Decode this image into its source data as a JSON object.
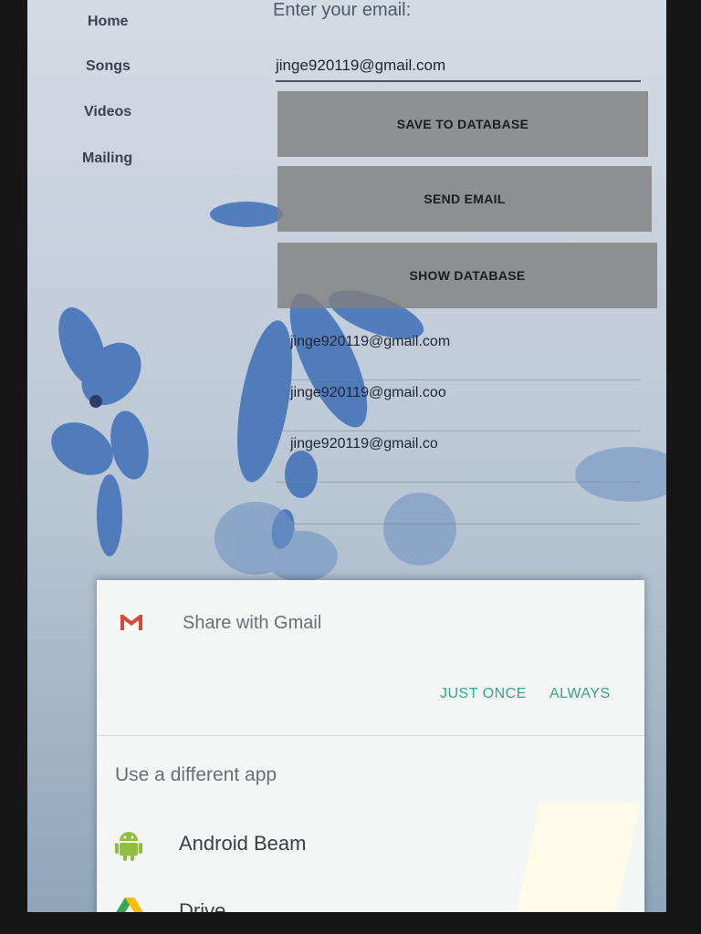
{
  "sidebar": {
    "items": [
      {
        "label": "Home"
      },
      {
        "label": "Songs"
      },
      {
        "label": "Videos"
      },
      {
        "label": "Mailing"
      }
    ]
  },
  "form": {
    "email_label": "Enter your email:",
    "email_value": "jinge920119@gmail.com",
    "save_button": "SAVE TO DATABASE",
    "send_button": "SEND EMAIL",
    "show_button": "SHOW DATABASE"
  },
  "database_list": [
    {
      "email": "jinge920119@gmail.com"
    },
    {
      "email": "jinge920119@gmail.coo"
    },
    {
      "email": "jinge920119@gmail.co"
    }
  ],
  "share_sheet": {
    "title": "Share with Gmail",
    "just_once": "JUST ONCE",
    "always": "ALWAYS",
    "different_app": "Use a different app",
    "apps": [
      {
        "label": "Android Beam",
        "icon": "android-icon"
      },
      {
        "label": "Drive",
        "icon": "drive-icon"
      }
    ]
  },
  "colors": {
    "accent": "#37a58c",
    "gmail_red": "#db4437",
    "android_green": "#8fbf3f"
  }
}
